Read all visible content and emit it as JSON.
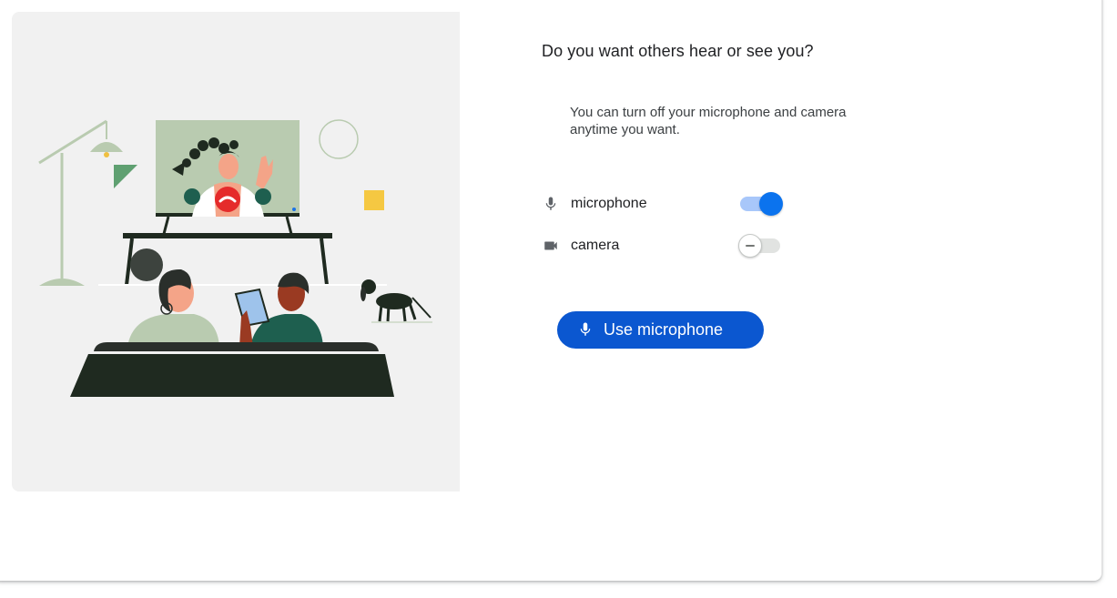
{
  "dialog": {
    "title": "Do you want others hear or see you?",
    "description": "You can turn off your microphone and camera anytime you want.",
    "settings": [
      {
        "label": "microphone",
        "icon": "microphone-icon",
        "enabled": true
      },
      {
        "label": "camera",
        "icon": "video-camera-icon",
        "enabled": false
      }
    ],
    "primary_button": {
      "label": "Use microphone",
      "icon": "microphone-icon"
    }
  },
  "colors": {
    "accent": "#0b57d0",
    "toggle_on": "#0b73ee",
    "toggle_track_on": "#a8c7fa",
    "illustration_bg": "#f1f1f1"
  }
}
